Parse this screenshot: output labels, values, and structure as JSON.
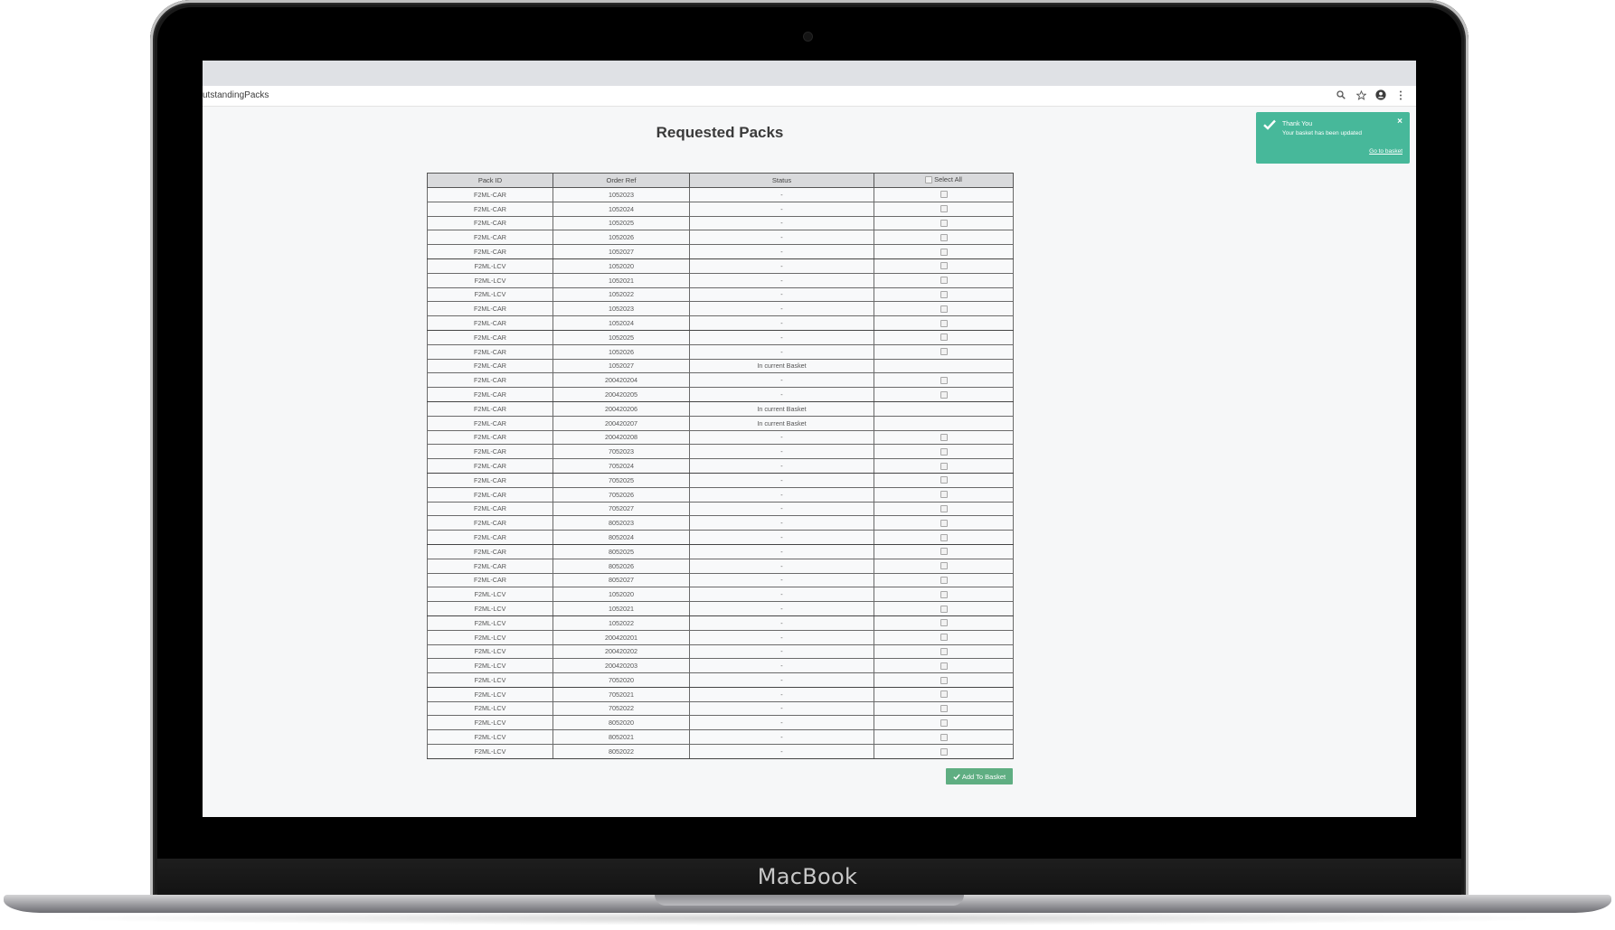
{
  "device": {
    "brand": "MacBook"
  },
  "browser": {
    "url": "utstandingPacks"
  },
  "page": {
    "title": "Requested Packs"
  },
  "table": {
    "headers": {
      "pack_id": "Pack ID",
      "order_ref": "Order Ref",
      "status": "Status",
      "select_all": "Select All"
    },
    "rows": [
      {
        "pack_id": "F2ML-CAR",
        "order_ref": "1052023",
        "status": "-",
        "checkbox": true
      },
      {
        "pack_id": "F2ML-CAR",
        "order_ref": "1052024",
        "status": "-",
        "checkbox": true
      },
      {
        "pack_id": "F2ML-CAR",
        "order_ref": "1052025",
        "status": "-",
        "checkbox": true
      },
      {
        "pack_id": "F2ML-CAR",
        "order_ref": "1052026",
        "status": "-",
        "checkbox": true
      },
      {
        "pack_id": "F2ML-CAR",
        "order_ref": "1052027",
        "status": "-",
        "checkbox": true
      },
      {
        "pack_id": "F2ML-LCV",
        "order_ref": "1052020",
        "status": "-",
        "checkbox": true
      },
      {
        "pack_id": "F2ML-LCV",
        "order_ref": "1052021",
        "status": "-",
        "checkbox": true
      },
      {
        "pack_id": "F2ML-LCV",
        "order_ref": "1052022",
        "status": "-",
        "checkbox": true
      },
      {
        "pack_id": "F2ML-CAR",
        "order_ref": "1052023",
        "status": "-",
        "checkbox": true
      },
      {
        "pack_id": "F2ML-CAR",
        "order_ref": "1052024",
        "status": "-",
        "checkbox": true
      },
      {
        "pack_id": "F2ML-CAR",
        "order_ref": "1052025",
        "status": "-",
        "checkbox": true
      },
      {
        "pack_id": "F2ML-CAR",
        "order_ref": "1052026",
        "status": "-",
        "checkbox": true
      },
      {
        "pack_id": "F2ML-CAR",
        "order_ref": "1052027",
        "status": "In current Basket",
        "checkbox": false
      },
      {
        "pack_id": "F2ML-CAR",
        "order_ref": "200420204",
        "status": "-",
        "checkbox": true
      },
      {
        "pack_id": "F2ML-CAR",
        "order_ref": "200420205",
        "status": "-",
        "checkbox": true
      },
      {
        "pack_id": "F2ML-CAR",
        "order_ref": "200420206",
        "status": "In current Basket",
        "checkbox": false
      },
      {
        "pack_id": "F2ML-CAR",
        "order_ref": "200420207",
        "status": "In current Basket",
        "checkbox": false
      },
      {
        "pack_id": "F2ML-CAR",
        "order_ref": "200420208",
        "status": "-",
        "checkbox": true
      },
      {
        "pack_id": "F2ML-CAR",
        "order_ref": "7052023",
        "status": "-",
        "checkbox": true
      },
      {
        "pack_id": "F2ML-CAR",
        "order_ref": "7052024",
        "status": "-",
        "checkbox": true
      },
      {
        "pack_id": "F2ML-CAR",
        "order_ref": "7052025",
        "status": "-",
        "checkbox": true
      },
      {
        "pack_id": "F2ML-CAR",
        "order_ref": "7052026",
        "status": "-",
        "checkbox": true
      },
      {
        "pack_id": "F2ML-CAR",
        "order_ref": "7052027",
        "status": "-",
        "checkbox": true
      },
      {
        "pack_id": "F2ML-CAR",
        "order_ref": "8052023",
        "status": "-",
        "checkbox": true
      },
      {
        "pack_id": "F2ML-CAR",
        "order_ref": "8052024",
        "status": "-",
        "checkbox": true
      },
      {
        "pack_id": "F2ML-CAR",
        "order_ref": "8052025",
        "status": "-",
        "checkbox": true
      },
      {
        "pack_id": "F2ML-CAR",
        "order_ref": "8052026",
        "status": "-",
        "checkbox": true
      },
      {
        "pack_id": "F2ML-CAR",
        "order_ref": "8052027",
        "status": "-",
        "checkbox": true
      },
      {
        "pack_id": "F2ML-LCV",
        "order_ref": "1052020",
        "status": "-",
        "checkbox": true
      },
      {
        "pack_id": "F2ML-LCV",
        "order_ref": "1052021",
        "status": "-",
        "checkbox": true
      },
      {
        "pack_id": "F2ML-LCV",
        "order_ref": "1052022",
        "status": "-",
        "checkbox": true
      },
      {
        "pack_id": "F2ML-LCV",
        "order_ref": "200420201",
        "status": "-",
        "checkbox": true
      },
      {
        "pack_id": "F2ML-LCV",
        "order_ref": "200420202",
        "status": "-",
        "checkbox": true
      },
      {
        "pack_id": "F2ML-LCV",
        "order_ref": "200420203",
        "status": "-",
        "checkbox": true
      },
      {
        "pack_id": "F2ML-LCV",
        "order_ref": "7052020",
        "status": "-",
        "checkbox": true
      },
      {
        "pack_id": "F2ML-LCV",
        "order_ref": "7052021",
        "status": "-",
        "checkbox": true
      },
      {
        "pack_id": "F2ML-LCV",
        "order_ref": "7052022",
        "status": "-",
        "checkbox": true
      },
      {
        "pack_id": "F2ML-LCV",
        "order_ref": "8052020",
        "status": "-",
        "checkbox": true
      },
      {
        "pack_id": "F2ML-LCV",
        "order_ref": "8052021",
        "status": "-",
        "checkbox": true
      },
      {
        "pack_id": "F2ML-LCV",
        "order_ref": "8052022",
        "status": "-",
        "checkbox": true
      }
    ]
  },
  "actions": {
    "add_to_basket": "Add To Basket"
  },
  "toast": {
    "title": "Thank You",
    "message": "Your basket has been updated",
    "link": "Go to basket",
    "close": "×"
  },
  "icons": {
    "browser": [
      "search-icon",
      "star-icon",
      "account-icon",
      "more-vert-icon"
    ],
    "toast": "check-icon",
    "button": "check-icon"
  },
  "colors": {
    "toast_bg": "#47b89a",
    "button_bg": "#5fae82",
    "page_bg": "#f6f7f8",
    "header_bg": "#d9dadc"
  }
}
